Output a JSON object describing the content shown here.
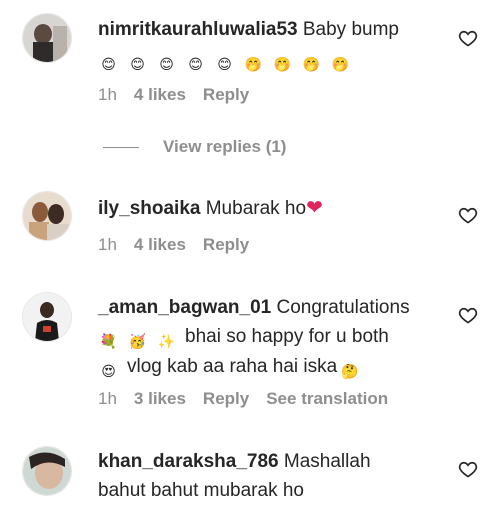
{
  "comments": [
    {
      "username": "nimritkaurahluwalia53",
      "text": "Baby bump",
      "emojis": [
        "😊",
        "😊",
        "😊",
        "😊",
        "😊",
        "🤭",
        "🤭",
        "🤭",
        "🤭"
      ],
      "time": "1h",
      "likes": "4 likes",
      "reply": "Reply"
    },
    {
      "username": "ily_shoaika",
      "text": "Mubarak ho",
      "time": "1h",
      "likes": "4 likes",
      "reply": "Reply"
    },
    {
      "username": "_aman_bagwan_01",
      "text": "Congratulations",
      "line2": "bhai so happy for u both",
      "line3": "vlog kab aa raha hai iska",
      "time": "1h",
      "likes": "3 likes",
      "reply": "Reply",
      "translate": "See translation"
    },
    {
      "username": "khan_daraksha_786",
      "text": "Mashallah",
      "line2": "bahut bahut mubarak ho"
    }
  ],
  "view_replies": "View replies (1)",
  "colors": {
    "secondary_text": "#8e8e8e",
    "heart": "#e0245e"
  }
}
